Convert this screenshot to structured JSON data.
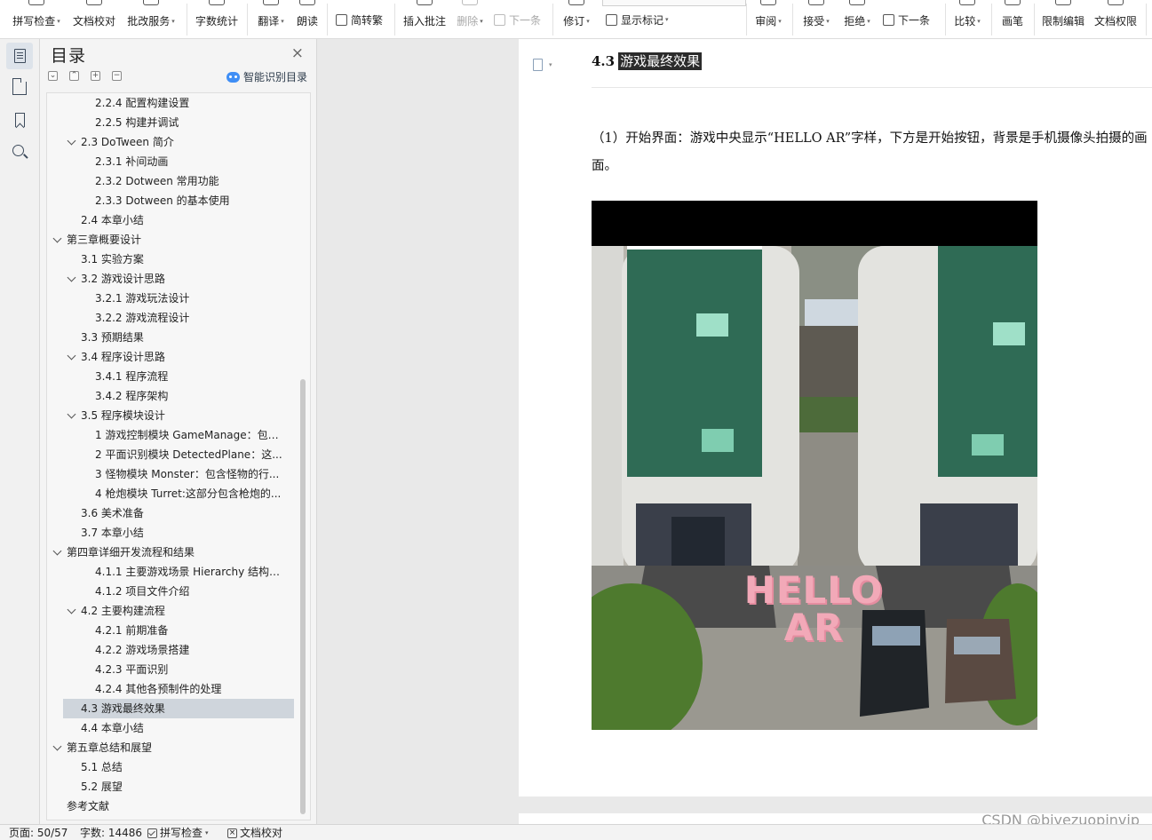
{
  "ribbon": {
    "buttons": [
      {
        "label": "拼写检查",
        "caret": true,
        "disabled": false
      },
      {
        "label": "文档校对",
        "caret": false,
        "disabled": false
      },
      {
        "label": "批改服务",
        "caret": true,
        "disabled": false
      },
      {
        "label": "字数统计",
        "caret": false,
        "disabled": false
      },
      {
        "label": "翻译",
        "caret": true,
        "disabled": false
      },
      {
        "label": "朗读",
        "caret": false,
        "disabled": false
      },
      {
        "label": "简转繁",
        "caret": false,
        "disabled": false
      },
      {
        "label": "插入批注",
        "caret": false,
        "disabled": false
      },
      {
        "label": "删除",
        "caret": true,
        "disabled": true
      },
      {
        "label": "下一条",
        "caret": false,
        "disabled": true
      },
      {
        "label": "修订",
        "caret": true,
        "disabled": false
      },
      {
        "label": "显示标记",
        "caret": true,
        "disabled": false
      },
      {
        "label": "审阅",
        "caret": true,
        "disabled": false
      },
      {
        "label": "接受",
        "caret": true,
        "disabled": false
      },
      {
        "label": "拒绝",
        "caret": true,
        "disabled": false
      },
      {
        "label": "下一条",
        "caret": false,
        "disabled": false
      },
      {
        "label": "比较",
        "caret": true,
        "disabled": false
      },
      {
        "label": "画笔",
        "caret": false,
        "disabled": false
      },
      {
        "label": "限制编辑",
        "caret": false,
        "disabled": false
      },
      {
        "label": "文档权限",
        "caret": false,
        "disabled": false
      }
    ],
    "caret_glyph": "▾"
  },
  "toc": {
    "title": "目录",
    "close": "×",
    "smart_label": "智能识别目录",
    "toolbar": [
      "⌄",
      "⌃",
      "+",
      "−"
    ],
    "items": [
      {
        "text": "2.2.4 配置构建设置",
        "level": 3,
        "chevron": false,
        "selected": false
      },
      {
        "text": "2.2.5 构建并调试",
        "level": 3,
        "chevron": false,
        "selected": false
      },
      {
        "text": "2.3 DoTween 简介",
        "level": 2,
        "chevron": true,
        "selected": false
      },
      {
        "text": "2.3.1 补间动画",
        "level": 3,
        "chevron": false,
        "selected": false
      },
      {
        "text": "2.3.2 Dotween 常用功能",
        "level": 3,
        "chevron": false,
        "selected": false
      },
      {
        "text": "2.3.3 Dotween 的基本使用",
        "level": 3,
        "chevron": false,
        "selected": false
      },
      {
        "text": "2.4 本章小结",
        "level": 2,
        "chevron": false,
        "selected": false
      },
      {
        "text": "第三章概要设计",
        "level": 1,
        "chevron": true,
        "selected": false
      },
      {
        "text": "3.1 实验方案",
        "level": 2,
        "chevron": false,
        "selected": false
      },
      {
        "text": "3.2 游戏设计思路",
        "level": 2,
        "chevron": true,
        "selected": false
      },
      {
        "text": "3.2.1 游戏玩法设计",
        "level": 3,
        "chevron": false,
        "selected": false
      },
      {
        "text": "3.2.2 游戏流程设计",
        "level": 3,
        "chevron": false,
        "selected": false
      },
      {
        "text": "3.3 预期结果",
        "level": 2,
        "chevron": false,
        "selected": false
      },
      {
        "text": "3.4 程序设计思路",
        "level": 2,
        "chevron": true,
        "selected": false
      },
      {
        "text": "3.4.1 程序流程",
        "level": 3,
        "chevron": false,
        "selected": false
      },
      {
        "text": "3.4.2 程序架构",
        "level": 3,
        "chevron": false,
        "selected": false
      },
      {
        "text": "3.5 程序模块设计",
        "level": 2,
        "chevron": true,
        "selected": false
      },
      {
        "text": "1 游戏控制模块 GameManage：包含...",
        "level": 3,
        "chevron": false,
        "selected": false
      },
      {
        "text": "2 平面识别模块 DetectedPlane：这...",
        "level": 3,
        "chevron": false,
        "selected": false
      },
      {
        "text": "3 怪物模块 Monster：包含怪物的行...",
        "level": 3,
        "chevron": false,
        "selected": false
      },
      {
        "text": "4 枪炮模块 Turret:这部分包含枪炮的...",
        "level": 3,
        "chevron": false,
        "selected": false
      },
      {
        "text": "3.6 美术准备",
        "level": 2,
        "chevron": false,
        "selected": false
      },
      {
        "text": "3.7 本章小结",
        "level": 2,
        "chevron": false,
        "selected": false
      },
      {
        "text": "第四章详细开发流程和结果",
        "level": 1,
        "chevron": true,
        "selected": false
      },
      {
        "text": "4.1.1 主要游戏场景 Hierarchy 结构介...",
        "level": 3,
        "chevron": false,
        "selected": false
      },
      {
        "text": "4.1.2 项目文件介绍",
        "level": 3,
        "chevron": false,
        "selected": false
      },
      {
        "text": "4.2 主要构建流程",
        "level": 2,
        "chevron": true,
        "selected": false
      },
      {
        "text": "4.2.1 前期准备",
        "level": 3,
        "chevron": false,
        "selected": false
      },
      {
        "text": "4.2.2 游戏场景搭建",
        "level": 3,
        "chevron": false,
        "selected": false
      },
      {
        "text": "4.2.3 平面识别",
        "level": 3,
        "chevron": false,
        "selected": false
      },
      {
        "text": "4.2.4 其他各预制件的处理",
        "level": 3,
        "chevron": false,
        "selected": false
      },
      {
        "text": "4.3 游戏最终效果",
        "level": 2,
        "chevron": false,
        "selected": true
      },
      {
        "text": "4.4 本章小结",
        "level": 2,
        "chevron": false,
        "selected": false
      },
      {
        "text": "第五章总结和展望",
        "level": 1,
        "chevron": true,
        "selected": false
      },
      {
        "text": "5.1 总结",
        "level": 2,
        "chevron": false,
        "selected": false
      },
      {
        "text": "5.2 展望",
        "level": 2,
        "chevron": false,
        "selected": false
      },
      {
        "text": "参考文献",
        "level": 1,
        "chevron": false,
        "selected": false
      }
    ]
  },
  "document": {
    "heading_number": "4.3",
    "heading_text": "游戏最终效果",
    "paragraph": "（1）开始界面：游戏中央显示“HELLO AR”字样，下方是开始按钮，背景是手机摄像头拍摄的画面。",
    "image_overlay_line1": "HELLO",
    "image_overlay_line2": "AR"
  },
  "statusbar": {
    "page": "页面: 50/57",
    "words": "字数: 14486",
    "spell": "拼写检查",
    "proof": "文档校对",
    "caret": "▾"
  },
  "watermark": "CSDN @biyezuopinvip",
  "colors": {
    "selected_row": "#cfd5dc",
    "overlay_pink": "#f2a9b8",
    "robot_blue": "#3f8ef5"
  }
}
